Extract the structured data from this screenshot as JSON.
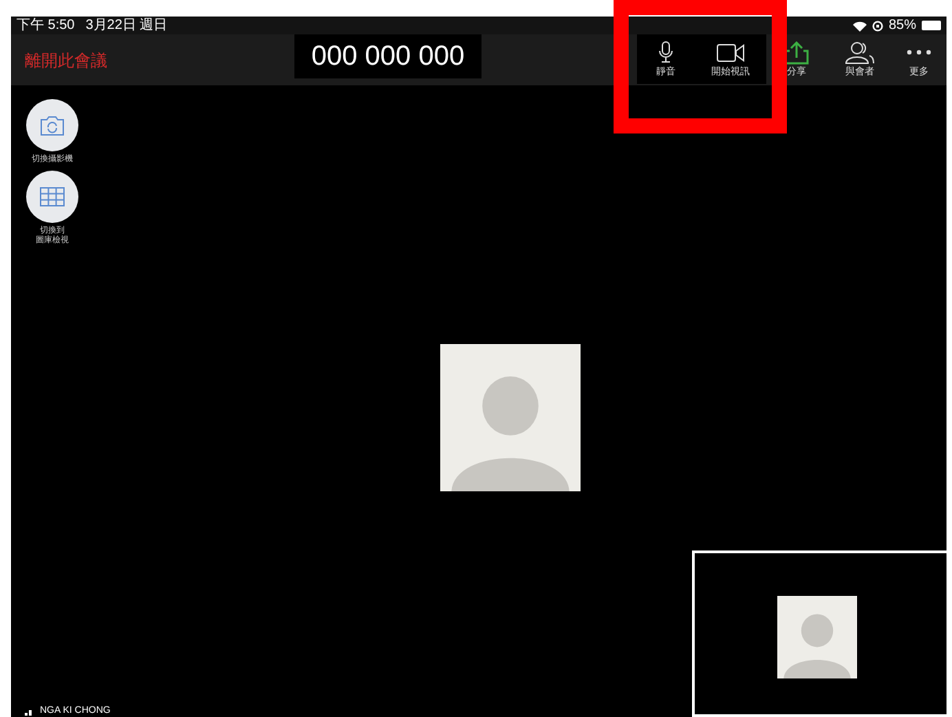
{
  "status_bar": {
    "time": "下午 5:50",
    "date": "3月22日 週日",
    "battery": "85%"
  },
  "top_bar": {
    "leave": "離開此會議",
    "meeting_id": "000 000 000",
    "actions": [
      {
        "kind": "mic",
        "label": "靜音"
      },
      {
        "kind": "video",
        "label": "開始視訊"
      },
      {
        "kind": "share",
        "label": "分享"
      },
      {
        "kind": "participants",
        "label": "與會者"
      },
      {
        "kind": "more",
        "label": "更多"
      }
    ]
  },
  "side_controls": [
    {
      "kind": "camera",
      "lines": [
        "切換攝影機"
      ]
    },
    {
      "kind": "grid",
      "lines": [
        "切換到",
        "圖庫檢視"
      ]
    }
  ],
  "participant_name": "NGA KI CHONG"
}
